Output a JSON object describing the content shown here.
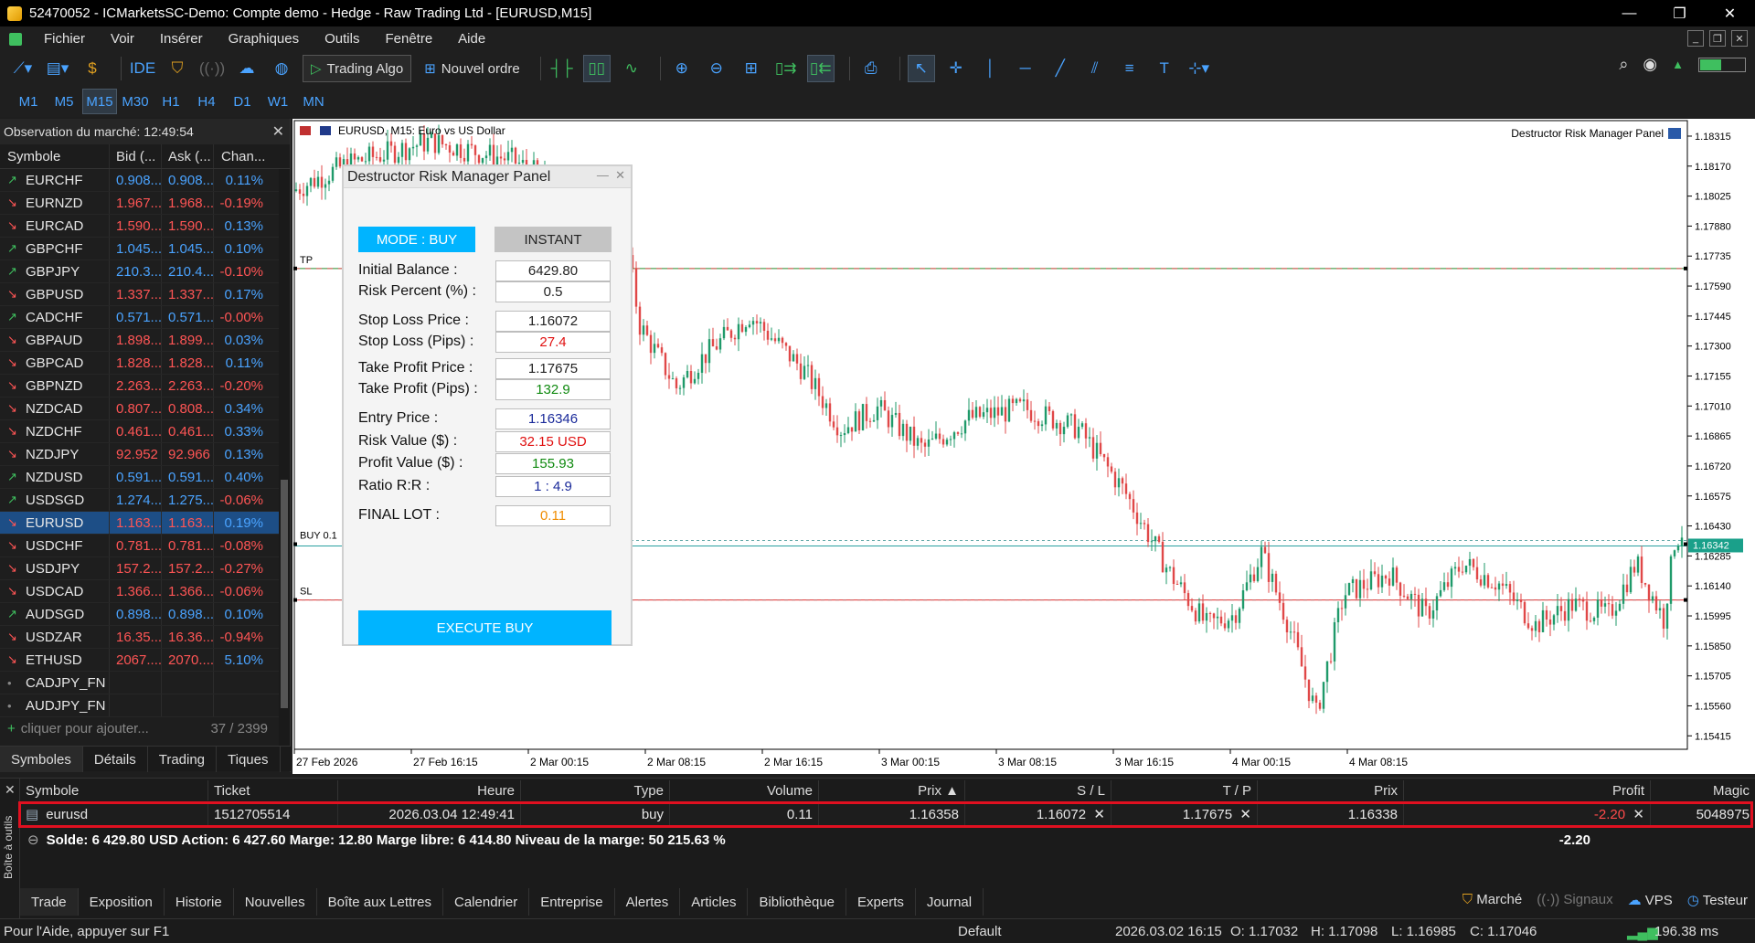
{
  "window": {
    "title": "52470052 - ICMarketsSC-Demo: Compte demo - Hedge - Raw Trading Ltd - [EURUSD,M15]"
  },
  "menu": [
    "Fichier",
    "Voir",
    "Insérer",
    "Graphiques",
    "Outils",
    "Fenêtre",
    "Aide"
  ],
  "toolbar": {
    "ide": "IDE",
    "algo": "Trading Algo",
    "new_order": "Nouvel ordre"
  },
  "timeframes": [
    "M1",
    "M5",
    "M15",
    "M30",
    "H1",
    "H4",
    "D1",
    "W1",
    "MN"
  ],
  "timeframe_active": "M15",
  "market_watch": {
    "header": "Observation du marché: 12:49:54",
    "columns": [
      "Symbole",
      "Bid (...",
      "Ask (...",
      "Chan..."
    ],
    "rows": [
      {
        "sym": "EURCHF",
        "bid": "0.908...",
        "ask": "0.908...",
        "chg": "0.11%",
        "dir": "u"
      },
      {
        "sym": "EURNZD",
        "bid": "1.967...",
        "ask": "1.968...",
        "chg": "-0.19%",
        "dir": "d"
      },
      {
        "sym": "EURCAD",
        "bid": "1.590...",
        "ask": "1.590...",
        "chg": "0.13%",
        "dir": "d"
      },
      {
        "sym": "GBPCHF",
        "bid": "1.045...",
        "ask": "1.045...",
        "chg": "0.10%",
        "dir": "u"
      },
      {
        "sym": "GBPJPY",
        "bid": "210.3...",
        "ask": "210.4...",
        "chg": "-0.10%",
        "dir": "u"
      },
      {
        "sym": "GBPUSD",
        "bid": "1.337...",
        "ask": "1.337...",
        "chg": "0.17%",
        "dir": "d"
      },
      {
        "sym": "CADCHF",
        "bid": "0.571...",
        "ask": "0.571...",
        "chg": "-0.00%",
        "dir": "u"
      },
      {
        "sym": "GBPAUD",
        "bid": "1.898...",
        "ask": "1.899...",
        "chg": "0.03%",
        "dir": "d"
      },
      {
        "sym": "GBPCAD",
        "bid": "1.828...",
        "ask": "1.828...",
        "chg": "0.11%",
        "dir": "d"
      },
      {
        "sym": "GBPNZD",
        "bid": "2.263...",
        "ask": "2.263...",
        "chg": "-0.20%",
        "dir": "d"
      },
      {
        "sym": "NZDCAD",
        "bid": "0.807...",
        "ask": "0.808...",
        "chg": "0.34%",
        "dir": "d"
      },
      {
        "sym": "NZDCHF",
        "bid": "0.461...",
        "ask": "0.461...",
        "chg": "0.33%",
        "dir": "d"
      },
      {
        "sym": "NZDJPY",
        "bid": "92.952",
        "ask": "92.966",
        "chg": "0.13%",
        "dir": "d"
      },
      {
        "sym": "NZDUSD",
        "bid": "0.591...",
        "ask": "0.591...",
        "chg": "0.40%",
        "dir": "u"
      },
      {
        "sym": "USDSGD",
        "bid": "1.274...",
        "ask": "1.275...",
        "chg": "-0.06%",
        "dir": "u"
      },
      {
        "sym": "EURUSD",
        "bid": "1.163...",
        "ask": "1.163...",
        "chg": "0.19%",
        "dir": "d",
        "selected": true
      },
      {
        "sym": "USDCHF",
        "bid": "0.781...",
        "ask": "0.781...",
        "chg": "-0.08%",
        "dir": "d"
      },
      {
        "sym": "USDJPY",
        "bid": "157.2...",
        "ask": "157.2...",
        "chg": "-0.27%",
        "dir": "d"
      },
      {
        "sym": "USDCAD",
        "bid": "1.366...",
        "ask": "1.366...",
        "chg": "-0.06%",
        "dir": "d"
      },
      {
        "sym": "AUDSGD",
        "bid": "0.898...",
        "ask": "0.898...",
        "chg": "0.10%",
        "dir": "u"
      },
      {
        "sym": "USDZAR",
        "bid": "16.35...",
        "ask": "16.36...",
        "chg": "-0.94%",
        "dir": "d"
      },
      {
        "sym": "ETHUSD",
        "bid": "2067....",
        "ask": "2070....",
        "chg": "5.10%",
        "dir": "d"
      },
      {
        "sym": "CADJPY_FN",
        "bid": "",
        "ask": "",
        "chg": "",
        "dir": "n"
      },
      {
        "sym": "AUDJPY_FN",
        "bid": "",
        "ask": "",
        "chg": "",
        "dir": "n"
      }
    ],
    "add_placeholder": "cliquer pour ajouter...",
    "count": "37 / 2399",
    "tabs": [
      "Symboles",
      "Détails",
      "Trading",
      "Tiques"
    ]
  },
  "chart": {
    "symbol_label": "EURUSD, M15:  Euro vs US Dollar",
    "indicator_label": "Destructor Risk Manager Panel",
    "price_ticks": [
      "1.18315",
      "1.18170",
      "1.18025",
      "1.17880",
      "1.17735",
      "1.17590",
      "1.17445",
      "1.17300",
      "1.17155",
      "1.17010",
      "1.16865",
      "1.16720",
      "1.16575",
      "1.16430",
      "1.16285",
      "1.16140",
      "1.15995",
      "1.15850",
      "1.15705",
      "1.15560",
      "1.15415"
    ],
    "time_ticks": [
      "27 Feb 2026",
      "27 Feb 16:15",
      "2 Mar 00:15",
      "2 Mar 08:15",
      "2 Mar 16:15",
      "3 Mar 00:15",
      "3 Mar 08:15",
      "3 Mar 16:15",
      "4 Mar 00:15",
      "4 Mar 08:15"
    ],
    "current_price": "1.16342",
    "tp_label": "TP",
    "buy_label": "BUY 0.1",
    "sl_label": "SL",
    "levels": {
      "tp": 1.17675,
      "entry": 1.16342,
      "sl": 1.16072
    },
    "range": [
      1.1535,
      1.1839
    ]
  },
  "panel": {
    "title": "Destructor Risk Manager Panel",
    "mode": "MODE : BUY",
    "instant": "INSTANT",
    "fields": [
      {
        "label": "Initial Balance :",
        "value": "6429.80",
        "color": "#222222"
      },
      {
        "label": "Risk Percent (%) :",
        "value": "0.5",
        "color": "#222222"
      },
      {
        "label": "Stop Loss Price :",
        "value": "1.16072",
        "color": "#222222"
      },
      {
        "label": "Stop Loss (Pips) :",
        "value": "27.4",
        "color": "#e01010"
      },
      {
        "label": "Take Profit Price :",
        "value": "1.17675",
        "color": "#222222"
      },
      {
        "label": "Take Profit (Pips) :",
        "value": "132.9",
        "color": "#108a10"
      },
      {
        "label": "Entry Price :",
        "value": "1.16346",
        "color": "#1a2a9a"
      },
      {
        "label": "Risk Value ($) :",
        "value": "32.15 USD",
        "color": "#e01010"
      },
      {
        "label": "Profit Value ($) :",
        "value": "155.93",
        "color": "#108a10"
      },
      {
        "label": "Ratio R:R :",
        "value": "1 : 4.9",
        "color": "#1a2a9a"
      },
      {
        "label": "FINAL LOT :",
        "value": "0.11",
        "color": "#f08c00"
      }
    ],
    "execute": "EXECUTE BUY"
  },
  "trade": {
    "columns": [
      "Symbole",
      "Ticket",
      "Heure",
      "Type",
      "Volume",
      "Prix",
      "S / L",
      "T / P",
      "Prix",
      "Profit",
      "Magic"
    ],
    "row": {
      "symbol": "eurusd",
      "ticket": "1512705514",
      "time": "2026.03.04 12:49:41",
      "type": "buy",
      "volume": "0.11",
      "price": "1.16358",
      "sl": "1.16072",
      "tp": "1.17675",
      "cur": "1.16338",
      "profit": "-2.20",
      "magic": "5048975"
    },
    "summary": "Solde: 6 429.80 USD  Action: 6 427.60  Marge: 12.80  Marge libre: 6 414.80  Niveau de la marge: 50 215.63 %",
    "summary_profit": "-2.20",
    "toolbox_label": "Boîte à outils",
    "tabs": [
      "Trade",
      "Exposition",
      "Historie",
      "Nouvelles",
      "Boîte aux Lettres",
      "Calendrier",
      "Entreprise",
      "Alertes",
      "Articles",
      "Bibliothèque",
      "Experts",
      "Journal"
    ],
    "right": [
      "Marché",
      "Signaux",
      "VPS",
      "Testeur"
    ]
  },
  "status": {
    "help": "Pour l'Aide, appuyer sur F1",
    "profile": "Default",
    "datetime": "2026.03.02 16:15",
    "open": "O: 1.17032",
    "high": "H: 1.17098",
    "low": "L: 1.16985",
    "close": "C: 1.17046",
    "ping": "196.38 ms"
  }
}
